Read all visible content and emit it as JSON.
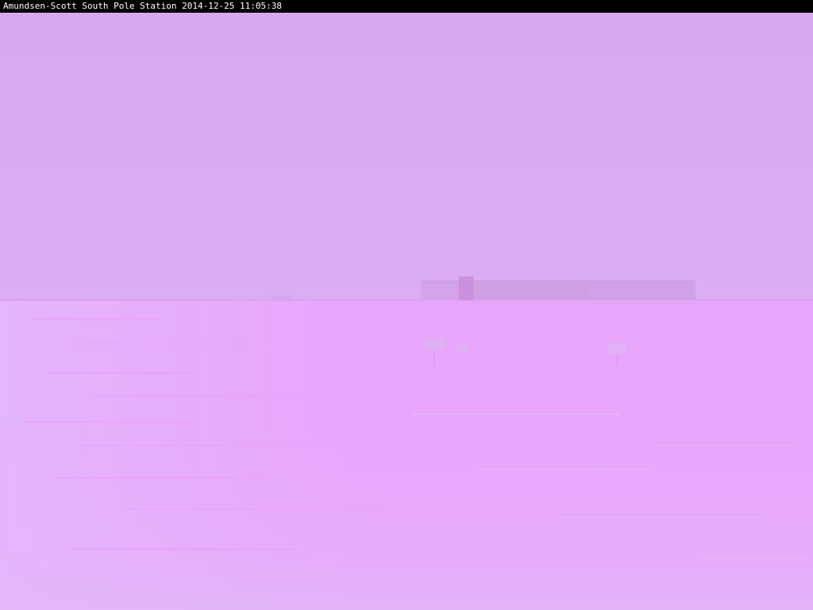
{
  "caption": {
    "text": "Amundsen-Scott South Pole Station 2014-12-25 11:05:38"
  },
  "colors": {
    "sky": "#d9aaf0",
    "ground": "#e8a6fb",
    "snow_pale": "#e3b3fb",
    "snow_shadow": "#ec9ffc",
    "building": "#cf9fe4",
    "building_tower": "#cc8fe0",
    "caption_bg": "#000000",
    "caption_fg": "#ffffff"
  },
  "scene": {
    "objects": [
      "station-building",
      "station-tower",
      "flag-marker-left",
      "flag-marker-right",
      "snow-field",
      "horizon"
    ]
  }
}
